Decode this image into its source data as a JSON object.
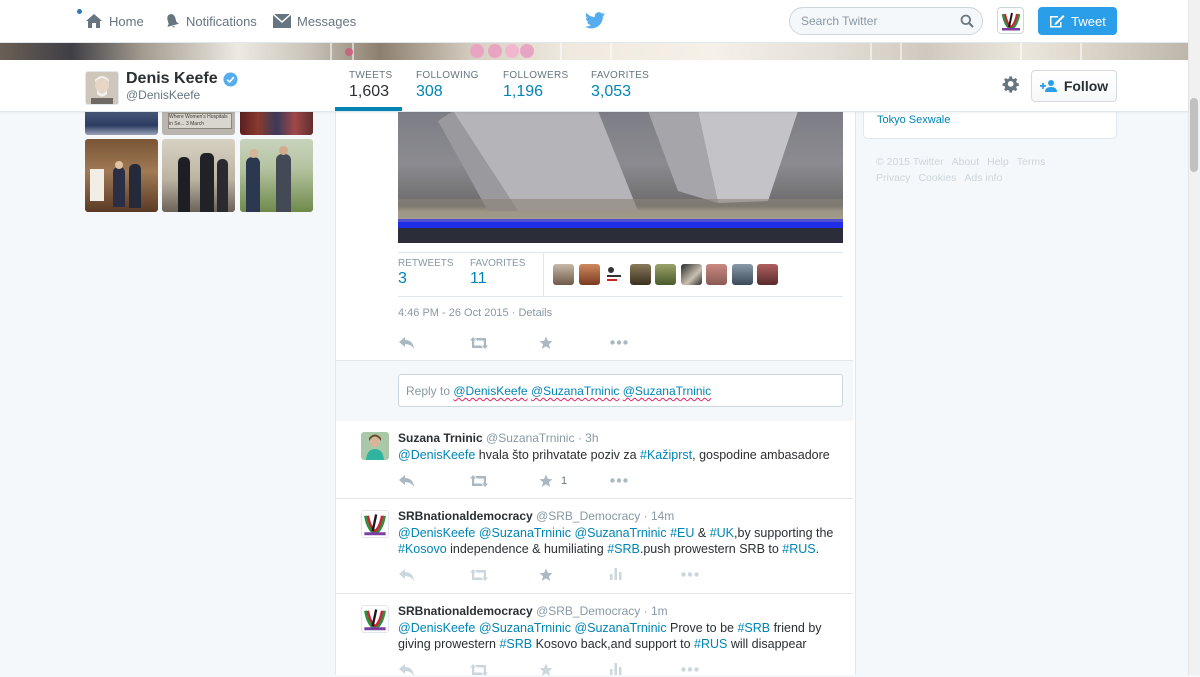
{
  "nav": {
    "home": "Home",
    "notifications": "Notifications",
    "messages": "Messages",
    "search_placeholder": "Search Twitter",
    "tweet_button": "Tweet"
  },
  "profile": {
    "name": "Denis Keefe",
    "handle": "@DenisKeefe",
    "follow_button": "Follow",
    "stats": [
      {
        "label": "TWEETS",
        "value": "1,603"
      },
      {
        "label": "FOLLOWING",
        "value": "308"
      },
      {
        "label": "FOLLOWERS",
        "value": "1,196"
      },
      {
        "label": "FAVORITES",
        "value": "3,053"
      }
    ]
  },
  "photo_grid_caption": "Where Women's Hospitals in Se... 3 March",
  "main_tweet": {
    "retweets_label": "RETWEETS",
    "retweets": "3",
    "favorites_label": "FAVORITES",
    "favorites": "11",
    "timestamp": "4:46 PM - 26 Oct 2015",
    "details": "Details",
    "separator": " · "
  },
  "reply": {
    "prefix": "Reply to ",
    "mentions": [
      "@DenisKeefe",
      "@SuzanaTrninic",
      "@SuzanaTrninic"
    ]
  },
  "replies": [
    {
      "name": "Suzana Trninic",
      "handle": "@SuzanaTrninic",
      "time": "3h",
      "parts": [
        {
          "t": "@DenisKeefe",
          "link": true
        },
        {
          "t": " hvala što prihvatate poziv za ",
          "link": false
        },
        {
          "t": "#Kažiprst",
          "link": true
        },
        {
          "t": ", gospodine ambasadore",
          "link": false
        }
      ],
      "favorite_count": "1"
    },
    {
      "name": "SRBnationaldemocracy",
      "handle": "@SRB_Democracy",
      "time": "14m",
      "parts": [
        {
          "t": "@DenisKeefe",
          "link": true
        },
        {
          "t": " ",
          "link": false
        },
        {
          "t": "@SuzanaTrninic",
          "link": true
        },
        {
          "t": " ",
          "link": false
        },
        {
          "t": "@SuzanaTrninic",
          "link": true
        },
        {
          "t": " ",
          "link": false
        },
        {
          "t": "#EU",
          "link": true
        },
        {
          "t": " & ",
          "link": false
        },
        {
          "t": "#UK",
          "link": true
        },
        {
          "t": ",by supporting the ",
          "link": false
        },
        {
          "t": "#Kosovo",
          "link": true
        },
        {
          "t": " independence & humiliating ",
          "link": false
        },
        {
          "t": "#SRB",
          "link": true
        },
        {
          "t": ".push prowestern SRB to ",
          "link": false
        },
        {
          "t": "#RUS",
          "link": true
        },
        {
          "t": ".",
          "link": false
        }
      ]
    },
    {
      "name": "SRBnationaldemocracy",
      "handle": "@SRB_Democracy",
      "time": "1m",
      "parts": [
        {
          "t": "@DenisKeefe",
          "link": true
        },
        {
          "t": " ",
          "link": false
        },
        {
          "t": "@SuzanaTrninic",
          "link": true
        },
        {
          "t": " ",
          "link": false
        },
        {
          "t": "@SuzanaTrninic",
          "link": true
        },
        {
          "t": " Prove to be ",
          "link": false
        },
        {
          "t": "#SRB",
          "link": true
        },
        {
          "t": " friend by giving prowestern ",
          "link": false
        },
        {
          "t": "#SRB",
          "link": true
        },
        {
          "t": " Kosovo back,and support to ",
          "link": false
        },
        {
          "t": "#RUS",
          "link": true
        },
        {
          "t": " will disappear",
          "link": false
        }
      ]
    }
  ],
  "right": {
    "card_link": "Tokyo Sexwale",
    "footer_links": [
      "© 2015 Twitter",
      "About",
      "Help",
      "Terms",
      "Privacy",
      "Cookies",
      "Ads info"
    ]
  },
  "colors": {
    "link": "#0084b4",
    "tweet_button_bg": "#2b9eea",
    "text": "#292f33",
    "muted": "#8899a6"
  }
}
